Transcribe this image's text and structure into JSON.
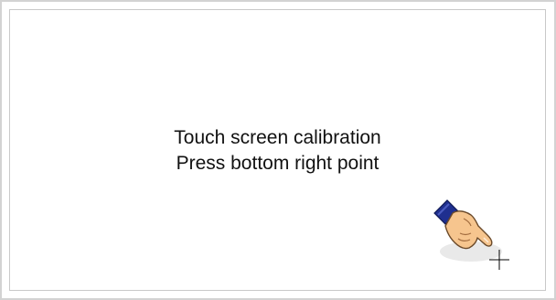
{
  "calibration": {
    "title": "Touch screen calibration",
    "instruction": "Press bottom right point",
    "target_point": "bottom-right"
  },
  "icons": {
    "hand": "pointing-hand-icon",
    "target": "crosshair-icon"
  },
  "colors": {
    "background": "#ffffff",
    "frame_border": "#d3d3d3",
    "text": "#111111",
    "skin": "#f6c58e",
    "cuff": "#1f2f8f",
    "crosshair": "#000000"
  }
}
